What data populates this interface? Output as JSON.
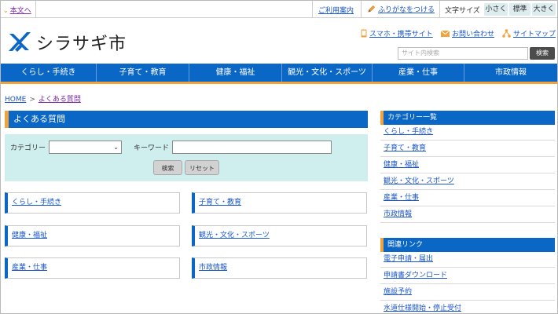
{
  "topbar": {
    "skip_link": "本文へ",
    "guide": "ご利用案内",
    "furigana": "ふりがなをつける",
    "font_size_label": "文字サイズ",
    "font_small": "小さく",
    "font_standard": "標準",
    "font_large": "大きく"
  },
  "header": {
    "site_name": "シラサギ市",
    "links": [
      "スマホ・携帯サイト",
      "お問い合わせ",
      "サイトマップ"
    ],
    "search_placeholder": "サイト内検索",
    "search_button": "検索"
  },
  "nav": [
    "くらし・手続き",
    "子育て・教育",
    "健康・福祉",
    "観光・文化・スポーツ",
    "産業・仕事",
    "市政情報"
  ],
  "breadcrumb": {
    "home": "HOME",
    "separator": ">",
    "current": "よくある質問"
  },
  "main": {
    "title": "よくある質問",
    "filter": {
      "category_label": "カテゴリー",
      "category_value": "",
      "keyword_label": "キーワード",
      "keyword_value": "",
      "search_button": "検索",
      "reset_button": "リセット"
    },
    "categories": [
      "くらし・手続き",
      "子育て・教育",
      "健康・福祉",
      "観光・文化・スポーツ",
      "産業・仕事",
      "市政情報"
    ]
  },
  "sidebar": {
    "category_title": "カテゴリー一覧",
    "category_items": [
      "くらし・手続き",
      "子育て・教育",
      "健康・福祉",
      "観光・文化・スポーツ",
      "産業・仕事",
      "市政情報"
    ],
    "links_title": "関連リンク",
    "link_items": [
      "電子申請・届出",
      "申請書ダウンロード",
      "施設予約",
      "水道仕様開始・停止受付"
    ]
  },
  "colors": {
    "brand_blue": "#0b67c6",
    "accent_orange": "#f3a33c",
    "filter_bg": "#cfeeee",
    "link": "#1a55c8"
  }
}
